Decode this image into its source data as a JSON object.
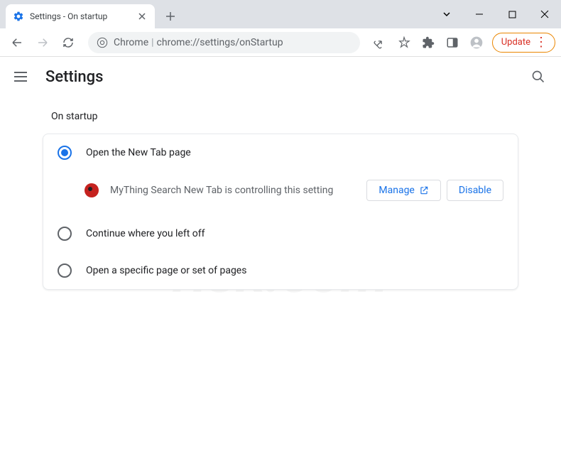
{
  "tab": {
    "title": "Settings - On startup"
  },
  "omnibox": {
    "label": "Chrome",
    "url": "chrome://settings/onStartup"
  },
  "toolbar": {
    "update_label": "Update"
  },
  "settings": {
    "title": "Settings",
    "section_title": "On startup",
    "options": [
      {
        "label": "Open the New Tab page",
        "selected": true
      },
      {
        "label": "Continue where you left off",
        "selected": false
      },
      {
        "label": "Open a specific page or set of pages",
        "selected": false
      }
    ],
    "extension": {
      "message": "MyThing Search New Tab is controlling this setting",
      "manage_label": "Manage",
      "disable_label": "Disable"
    }
  },
  "watermark": {
    "line1": "PC",
    "line2": "risk.com"
  }
}
